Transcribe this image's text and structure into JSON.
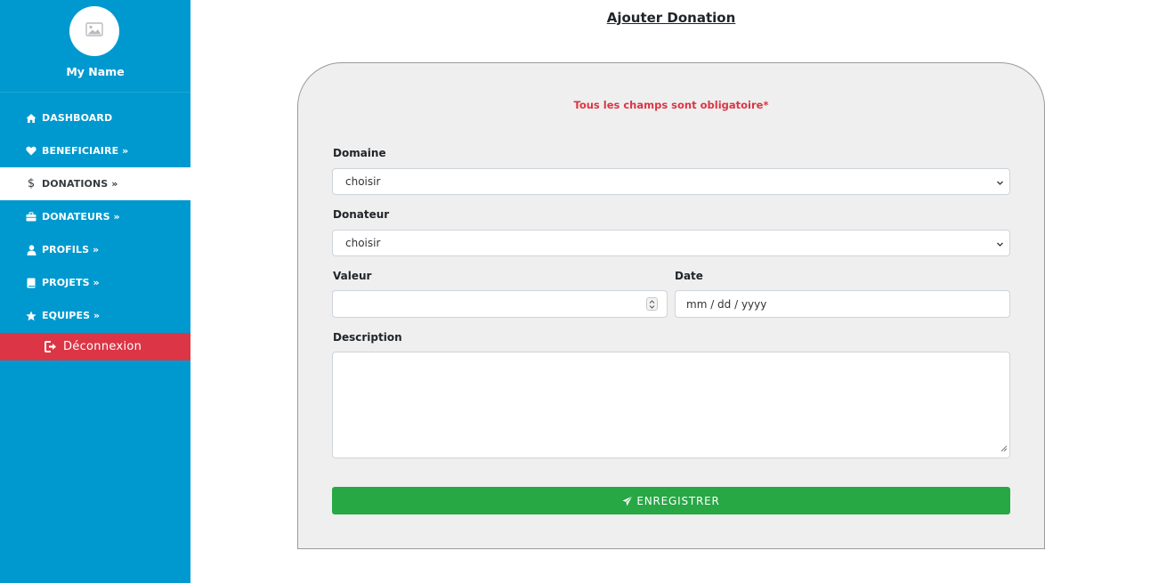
{
  "sidebar": {
    "profile_name": "My Name",
    "items": [
      {
        "label": "DASHBOARD",
        "icon": "home-icon"
      },
      {
        "label": "BENEFICIAIRE »",
        "icon": "heart-icon"
      },
      {
        "label": "DONATIONS »",
        "icon": "dollar-icon",
        "active": true
      },
      {
        "label": "DONATEURS »",
        "icon": "briefcase-icon"
      },
      {
        "label": "PROFILS »",
        "icon": "user-icon"
      },
      {
        "label": "PROJETS »",
        "icon": "book-icon"
      },
      {
        "label": "EQUIPES »",
        "icon": "star-icon"
      }
    ],
    "logout_label": "Déconnexion"
  },
  "main": {
    "title": "Ajouter Donation",
    "notice": "Tous les champs sont obligatoire*",
    "form": {
      "domaine_label": "Domaine",
      "domaine_value": "choisir",
      "donateur_label": "Donateur",
      "donateur_value": "choisir",
      "valeur_label": "Valeur",
      "valeur_value": "",
      "date_label": "Date",
      "date_placeholder": "mm / dd / yyyy",
      "description_label": "Description",
      "description_value": "",
      "submit_label": "ENREGISTRER"
    }
  },
  "colors": {
    "sidebar_bg": "#0099cf",
    "logout_bg": "#dc3545",
    "notice": "#dc3545",
    "submit_bg": "#28a745",
    "card_bg": "#efefef"
  }
}
